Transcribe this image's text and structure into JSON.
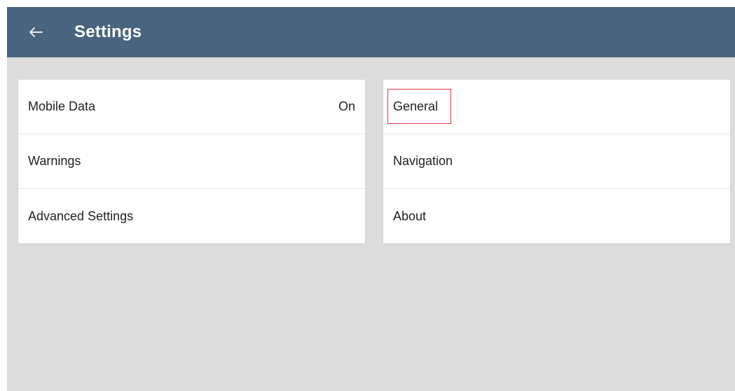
{
  "header": {
    "title": "Settings",
    "back_icon": "arrow-left-icon",
    "background_color": "#49647e"
  },
  "left_panel": {
    "items": [
      {
        "label": "Mobile Data",
        "value": "On"
      },
      {
        "label": "Warnings"
      },
      {
        "label": "Advanced Settings"
      }
    ]
  },
  "right_panel": {
    "items": [
      {
        "label": "General",
        "highlighted": true
      },
      {
        "label": "Navigation"
      },
      {
        "label": "About"
      }
    ]
  },
  "colors": {
    "background": "#dcdcdc",
    "card": "#ffffff",
    "highlight_border": "#e0393b"
  }
}
